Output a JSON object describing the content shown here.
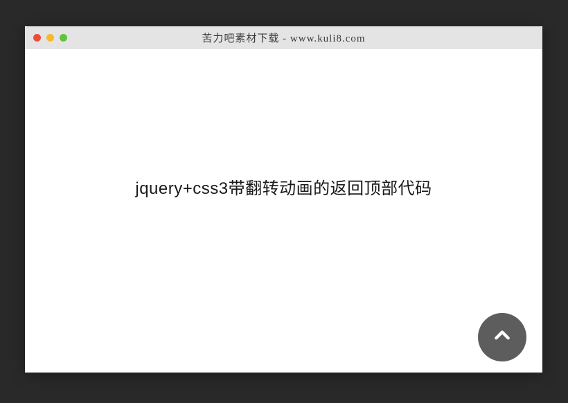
{
  "window": {
    "title": "苦力吧素材下载 - www.kuli8.com"
  },
  "content": {
    "heading": "jquery+css3带翻转动画的返回顶部代码"
  },
  "icons": {
    "back_to_top": "chevron-up-icon"
  }
}
